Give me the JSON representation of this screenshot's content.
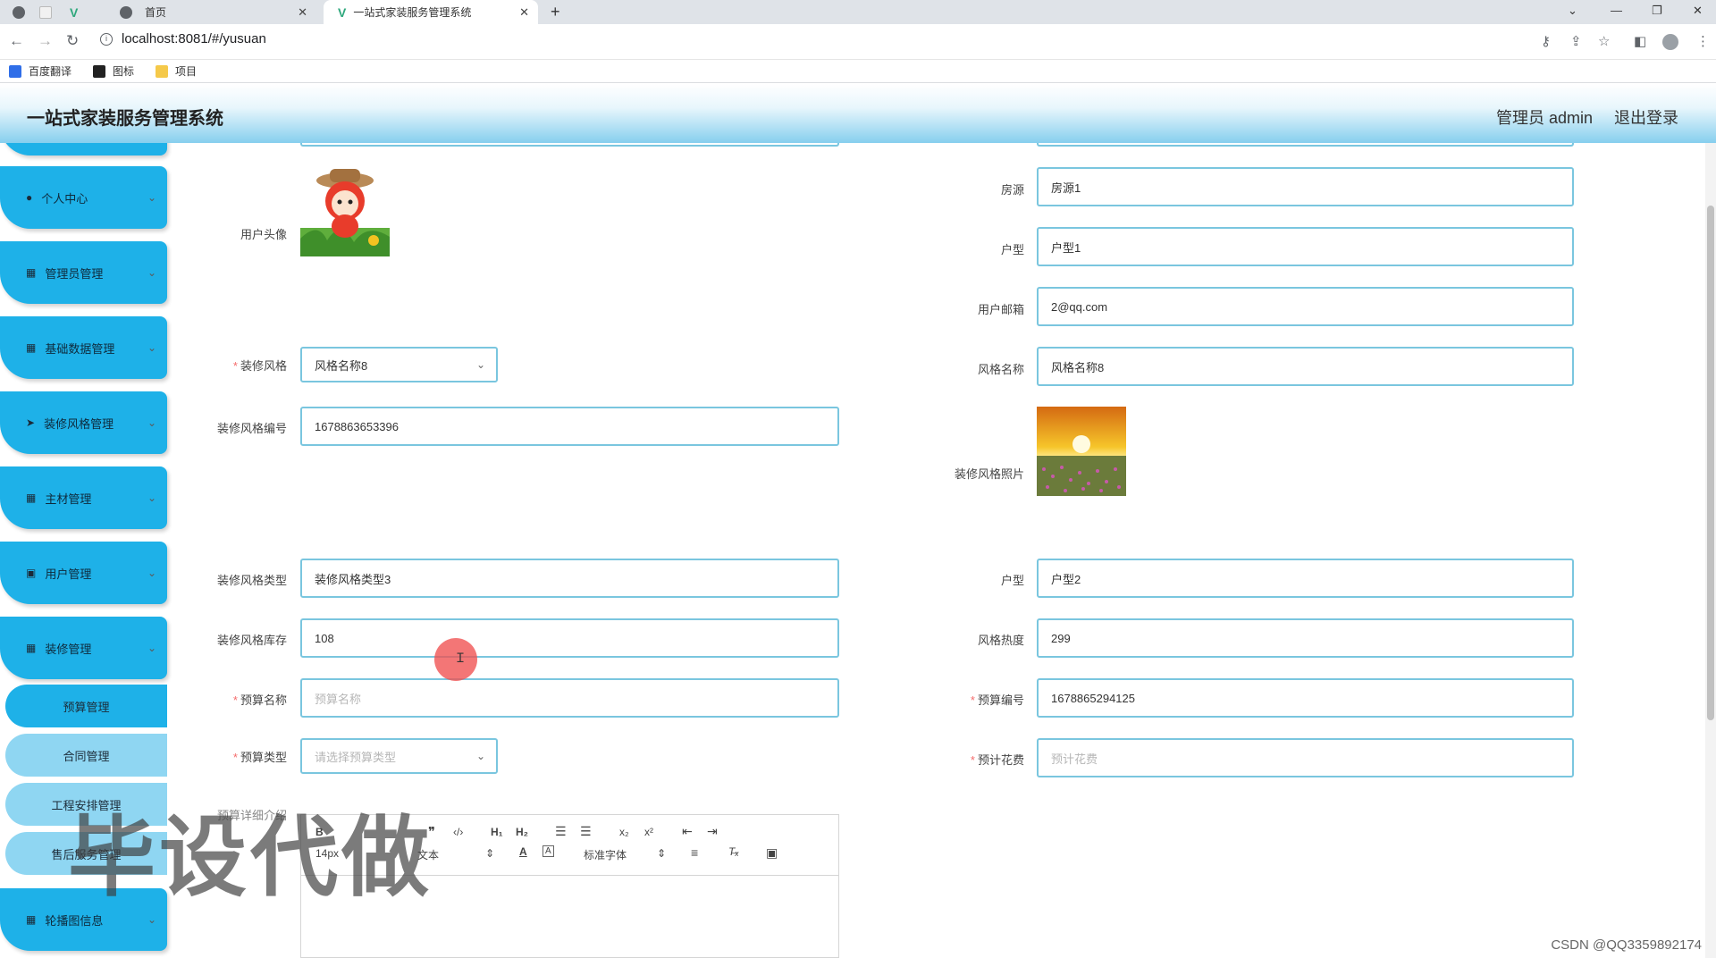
{
  "browser": {
    "tabs": [
      {
        "label": "首页"
      },
      {
        "label": "一站式家装服务管理系统"
      }
    ],
    "url": "localhost:8081/#/yusuan",
    "bookmarks": [
      "百度翻译",
      "图标",
      "项目"
    ]
  },
  "header": {
    "title": "一站式家装服务管理系统",
    "user": "管理员 admin",
    "logout": "退出登录"
  },
  "sidebar": {
    "menus": [
      {
        "label": "个人中心",
        "icon": "person-icon"
      },
      {
        "label": "管理员管理",
        "icon": "grid-icon"
      },
      {
        "label": "基础数据管理",
        "icon": "grid-icon"
      },
      {
        "label": "装修风格管理",
        "icon": "send-icon"
      },
      {
        "label": "主材管理",
        "icon": "grid-icon"
      },
      {
        "label": "用户管理",
        "icon": "trash-icon"
      },
      {
        "label": "装修管理",
        "icon": "grid-icon"
      }
    ],
    "subs": [
      "预算管理",
      "合同管理",
      "工程安排管理",
      "售后服务管理"
    ],
    "last_menu": {
      "label": "轮播图信息",
      "icon": "grid-icon"
    }
  },
  "form": {
    "user_avatar_label": "用户头像",
    "fangyuan_label": "房源",
    "fangyuan_value": "房源1",
    "huxing_label": "户型",
    "huxing_value": "户型1",
    "email_label": "用户邮箱",
    "email_value": "2@qq.com",
    "style_label": "装修风格",
    "style_value": "风格名称8",
    "style_name_label": "风格名称",
    "style_name_value": "风格名称8",
    "style_no_label": "装修风格编号",
    "style_no_value": "1678863653396",
    "style_photo_label": "装修风格照片",
    "style_type_label": "装修风格类型",
    "style_type_value": "装修风格类型3",
    "huxing2_label": "户型",
    "huxing2_value": "户型2",
    "stock_label": "装修风格库存",
    "stock_value": "108",
    "heat_label": "风格热度",
    "heat_value": "299",
    "budget_name_label": "预算名称",
    "budget_name_placeholder": "预算名称",
    "budget_no_label": "预算编号",
    "budget_no_value": "1678865294125",
    "budget_type_label": "预算类型",
    "budget_type_placeholder": "请选择预算类型",
    "cost_label": "预计花费",
    "cost_placeholder": "预计花费",
    "detail_label": "预算详细介绍"
  },
  "editor": {
    "font_size": "14px",
    "format": "文本",
    "font_family": "标准字体"
  },
  "overlay": {
    "watermark": "毕设代做",
    "credit": "CSDN @QQ3359892174"
  },
  "colors": {
    "accent": "#1eb1e8",
    "sub_light": "#8fd6f2",
    "input_border": "#7ac6df",
    "required": "#f56c6c"
  }
}
